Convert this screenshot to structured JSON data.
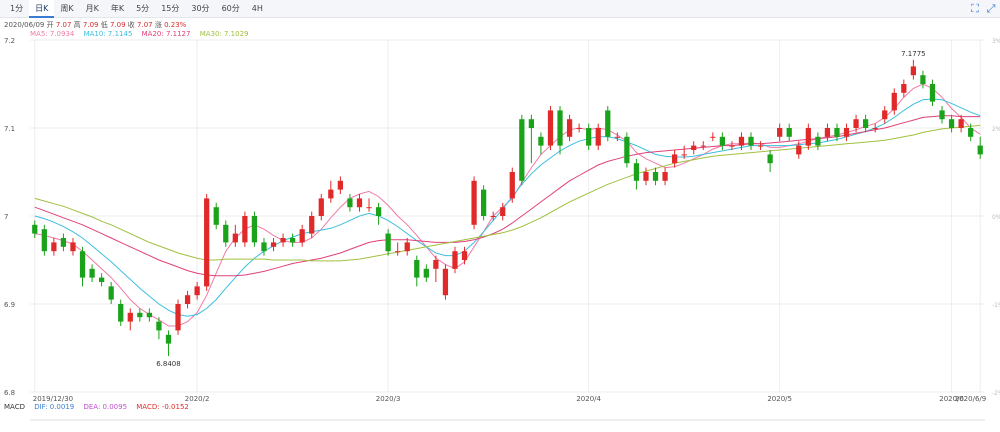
{
  "toolbar": {
    "tabs": [
      "1分",
      "日K",
      "周K",
      "月K",
      "年K",
      "5分",
      "15分",
      "30分",
      "60分",
      "4H"
    ],
    "active_tab": 1,
    "tool_icons": [
      "crosshair-icon",
      "fullscreen-icon"
    ]
  },
  "ohlc_bar": {
    "date": "2020/06/09",
    "open_label": "开",
    "open": "7.07",
    "high_label": "高",
    "high": "7.09",
    "low_label": "低",
    "low": "7.09",
    "close_label": "收",
    "close": "7.07",
    "change_label": "涨",
    "change": "0.23%"
  },
  "ma_legend": [
    {
      "label": "MA5: 7.0934",
      "color": "#f07aa6"
    },
    {
      "label": "MA10: 7.1145",
      "color": "#3bbfe0"
    },
    {
      "label": "MA20: 7.1127",
      "color": "#e0407a"
    },
    {
      "label": "MA30: 7.1029",
      "color": "#a0c040"
    }
  ],
  "macd_legend": [
    {
      "label": "MACD",
      "color": "#333333"
    },
    {
      "label": "DIF: 0.0019",
      "color": "#3a7bd5"
    },
    {
      "label": "DEA: 0.0095",
      "color": "#c050d0"
    },
    {
      "label": "MACD: -0.0152",
      "color": "#e02a2a"
    }
  ],
  "colors": {
    "up": "#e02a2a",
    "down": "#1aa31a",
    "grid": "#eeeeee"
  },
  "chart_data": {
    "type": "candlestick",
    "ylim": [
      6.8,
      7.2
    ],
    "y_ticks": [
      "6.8",
      "6.9",
      "7",
      "7.1",
      "7.2"
    ],
    "right_ticks": [
      "3%",
      "2%",
      "0%",
      "-1%",
      "-2%"
    ],
    "x_labels": [
      {
        "i": 0,
        "text": "2019/12/30"
      },
      {
        "i": 17,
        "text": "2020/2"
      },
      {
        "i": 37,
        "text": "2020/3"
      },
      {
        "i": 58,
        "text": "2020/4"
      },
      {
        "i": 78,
        "text": "2020/5"
      },
      {
        "i": 96,
        "text": "2020/6"
      },
      {
        "i": 99,
        "text": "2020/6/9"
      }
    ],
    "annotations": [
      {
        "i": 14,
        "text": "6.8408",
        "value": 6.8408,
        "pos": "below"
      },
      {
        "i": 92,
        "text": "7.1775",
        "value": 7.1775,
        "pos": "above"
      }
    ],
    "candles": [
      [
        6.99,
        6.98,
        6.995,
        6.975
      ],
      [
        6.985,
        6.96,
        6.99,
        6.955
      ],
      [
        6.96,
        6.97,
        6.975,
        6.955
      ],
      [
        6.975,
        6.965,
        6.98,
        6.96
      ],
      [
        6.96,
        6.97,
        6.975,
        6.955
      ],
      [
        6.96,
        6.93,
        6.965,
        6.92
      ],
      [
        6.94,
        6.93,
        6.945,
        6.925
      ],
      [
        6.93,
        6.925,
        6.935,
        6.92
      ],
      [
        6.92,
        6.905,
        6.925,
        6.9
      ],
      [
        6.9,
        6.88,
        6.905,
        6.875
      ],
      [
        6.88,
        6.89,
        6.895,
        6.87
      ],
      [
        6.89,
        6.885,
        6.895,
        6.88
      ],
      [
        6.89,
        6.885,
        6.895,
        6.88
      ],
      [
        6.88,
        6.87,
        6.885,
        6.86
      ],
      [
        6.865,
        6.855,
        6.87,
        6.8408
      ],
      [
        6.87,
        6.9,
        6.905,
        6.865
      ],
      [
        6.9,
        6.91,
        6.915,
        6.895
      ],
      [
        6.91,
        6.92,
        6.925,
        6.905
      ],
      [
        6.92,
        7.02,
        7.025,
        6.915
      ],
      [
        7.01,
        6.99,
        7.015,
        6.985
      ],
      [
        6.99,
        6.97,
        6.995,
        6.965
      ],
      [
        6.97,
        6.98,
        6.99,
        6.965
      ],
      [
        6.97,
        7.0,
        7.005,
        6.965
      ],
      [
        7.0,
        6.97,
        7.005,
        6.965
      ],
      [
        6.97,
        6.96,
        6.975,
        6.955
      ],
      [
        6.965,
        6.97,
        6.975,
        6.96
      ],
      [
        6.97,
        6.975,
        6.98,
        6.965
      ],
      [
        6.975,
        6.97,
        6.98,
        6.965
      ],
      [
        6.97,
        6.985,
        6.99,
        6.965
      ],
      [
        6.98,
        7.0,
        7.005,
        6.975
      ],
      [
        7.0,
        7.02,
        7.025,
        6.995
      ],
      [
        7.02,
        7.03,
        7.04,
        7.015
      ],
      [
        7.03,
        7.04,
        7.045,
        7.025
      ],
      [
        7.02,
        7.01,
        7.025,
        7.005
      ],
      [
        7.01,
        7.02,
        7.025,
        7.005
      ],
      [
        7.01,
        7.01,
        7.02,
        7.005
      ],
      [
        7.01,
        7.0,
        7.015,
        6.99
      ],
      [
        6.98,
        6.96,
        6.985,
        6.955
      ],
      [
        6.96,
        6.96,
        6.97,
        6.955
      ],
      [
        6.96,
        6.97,
        6.975,
        6.955
      ],
      [
        6.95,
        6.93,
        6.955,
        6.92
      ],
      [
        6.94,
        6.93,
        6.945,
        6.925
      ],
      [
        6.94,
        6.95,
        6.955,
        6.925
      ],
      [
        6.91,
        6.94,
        6.945,
        6.905
      ],
      [
        6.94,
        6.96,
        6.965,
        6.935
      ],
      [
        6.95,
        6.96,
        6.965,
        6.945
      ],
      [
        6.99,
        7.04,
        7.045,
        6.985
      ],
      [
        7.03,
        7.0,
        7.035,
        6.995
      ],
      [
        7.0,
        7.0,
        7.005,
        6.995
      ],
      [
        7.0,
        7.01,
        7.015,
        6.995
      ],
      [
        7.02,
        7.05,
        7.055,
        7.015
      ],
      [
        7.11,
        7.04,
        7.115,
        7.035
      ],
      [
        7.11,
        7.1,
        7.115,
        7.06
      ],
      [
        7.09,
        7.08,
        7.095,
        7.07
      ],
      [
        7.08,
        7.12,
        7.125,
        7.075
      ],
      [
        7.12,
        7.08,
        7.125,
        7.07
      ],
      [
        7.09,
        7.11,
        7.115,
        7.085
      ],
      [
        7.1,
        7.1,
        7.105,
        7.095
      ],
      [
        7.1,
        7.08,
        7.105,
        7.075
      ],
      [
        7.08,
        7.1,
        7.105,
        7.075
      ],
      [
        7.12,
        7.09,
        7.125,
        7.085
      ],
      [
        7.09,
        7.09,
        7.095,
        7.085
      ],
      [
        7.09,
        7.06,
        7.095,
        7.055
      ],
      [
        7.06,
        7.04,
        7.065,
        7.03
      ],
      [
        7.04,
        7.05,
        7.055,
        7.035
      ],
      [
        7.05,
        7.04,
        7.055,
        7.035
      ],
      [
        7.04,
        7.05,
        7.055,
        7.035
      ],
      [
        7.06,
        7.07,
        7.075,
        7.055
      ],
      [
        7.07,
        7.07,
        7.08,
        7.065
      ],
      [
        7.075,
        7.08,
        7.085,
        7.07
      ],
      [
        7.08,
        7.08,
        7.085,
        7.075
      ],
      [
        7.09,
        7.09,
        7.095,
        7.085
      ],
      [
        7.09,
        7.08,
        7.095,
        7.075
      ],
      [
        7.08,
        7.08,
        7.085,
        7.075
      ],
      [
        7.08,
        7.09,
        7.095,
        7.075
      ],
      [
        7.09,
        7.08,
        7.095,
        7.075
      ],
      [
        7.08,
        7.08,
        7.085,
        7.075
      ],
      [
        7.07,
        7.06,
        7.075,
        7.05
      ],
      [
        7.09,
        7.1,
        7.105,
        7.085
      ],
      [
        7.1,
        7.09,
        7.105,
        7.085
      ],
      [
        7.07,
        7.08,
        7.085,
        7.065
      ],
      [
        7.08,
        7.1,
        7.105,
        7.075
      ],
      [
        7.09,
        7.08,
        7.095,
        7.075
      ],
      [
        7.09,
        7.1,
        7.105,
        7.085
      ],
      [
        7.1,
        7.09,
        7.105,
        7.085
      ],
      [
        7.09,
        7.1,
        7.105,
        7.085
      ],
      [
        7.1,
        7.11,
        7.115,
        7.095
      ],
      [
        7.11,
        7.1,
        7.115,
        7.095
      ],
      [
        7.1,
        7.1,
        7.105,
        7.095
      ],
      [
        7.11,
        7.12,
        7.125,
        7.105
      ],
      [
        7.12,
        7.14,
        7.145,
        7.115
      ],
      [
        7.14,
        7.15,
        7.155,
        7.135
      ],
      [
        7.16,
        7.17,
        7.1775,
        7.155
      ],
      [
        7.16,
        7.15,
        7.165,
        7.145
      ],
      [
        7.15,
        7.13,
        7.155,
        7.125
      ],
      [
        7.12,
        7.11,
        7.125,
        7.105
      ],
      [
        7.11,
        7.1,
        7.115,
        7.095
      ],
      [
        7.1,
        7.11,
        7.115,
        7.095
      ],
      [
        7.1,
        7.09,
        7.105,
        7.085
      ],
      [
        7.08,
        7.07,
        7.09,
        7.065
      ]
    ],
    "series": [
      {
        "name": "MA5",
        "color": "#f07aa6",
        "values": [
          6.98,
          6.978,
          6.975,
          6.972,
          6.968,
          6.96,
          6.95,
          6.94,
          6.93,
          6.918,
          6.905,
          6.895,
          6.888,
          6.882,
          6.875,
          6.875,
          6.88,
          6.89,
          6.91,
          6.935,
          6.96,
          6.975,
          6.985,
          6.99,
          6.985,
          6.978,
          6.972,
          6.97,
          6.97,
          6.975,
          6.985,
          6.998,
          7.01,
          7.02,
          7.025,
          7.028,
          7.022,
          7.012,
          7.0,
          6.99,
          6.978,
          6.965,
          6.952,
          6.945,
          6.94,
          6.948,
          6.965,
          6.982,
          7.0,
          7.01,
          7.02,
          7.038,
          7.055,
          7.07,
          7.08,
          7.09,
          7.098,
          7.1,
          7.098,
          7.1,
          7.098,
          7.092,
          7.085,
          7.072,
          7.065,
          7.06,
          7.055,
          7.056,
          7.06,
          7.065,
          7.07,
          7.076,
          7.08,
          7.082,
          7.082,
          7.083,
          7.082,
          7.078,
          7.078,
          7.08,
          7.082,
          7.085,
          7.088,
          7.09,
          7.092,
          7.095,
          7.098,
          7.102,
          7.105,
          7.112,
          7.122,
          7.135,
          7.145,
          7.15,
          7.145,
          7.135,
          7.122,
          7.112,
          7.1,
          7.093
        ]
      },
      {
        "name": "MA10",
        "color": "#3bbfe0",
        "values": [
          7.0,
          6.997,
          6.993,
          6.988,
          6.982,
          6.975,
          6.966,
          6.957,
          6.948,
          6.938,
          6.928,
          6.918,
          6.909,
          6.9,
          6.893,
          6.888,
          6.886,
          6.888,
          6.895,
          6.905,
          6.918,
          6.93,
          6.942,
          6.952,
          6.96,
          6.966,
          6.972,
          6.976,
          6.98,
          6.982,
          6.984,
          6.986,
          6.99,
          6.995,
          7.0,
          7.003,
          7.0,
          6.995,
          6.988,
          6.98,
          6.972,
          6.965,
          6.958,
          6.955,
          6.955,
          6.96,
          6.97,
          6.982,
          6.995,
          7.008,
          7.022,
          7.036,
          7.048,
          7.058,
          7.066,
          7.074,
          7.08,
          7.085,
          7.088,
          7.09,
          7.09,
          7.088,
          7.084,
          7.08,
          7.075,
          7.07,
          7.068,
          7.067,
          7.067,
          7.068,
          7.07,
          7.072,
          7.074,
          7.076,
          7.078,
          7.08,
          7.08,
          7.08,
          7.08,
          7.08,
          7.081,
          7.082,
          7.083,
          7.085,
          7.087,
          7.09,
          7.093,
          7.096,
          7.1,
          7.105,
          7.112,
          7.12,
          7.127,
          7.132,
          7.133,
          7.132,
          7.128,
          7.123,
          7.118,
          7.114
        ]
      },
      {
        "name": "MA20",
        "color": "#e0407a",
        "values": [
          7.01,
          7.006,
          7.002,
          6.998,
          6.994,
          6.99,
          6.985,
          6.98,
          6.975,
          6.97,
          6.965,
          6.96,
          6.955,
          6.95,
          6.946,
          6.942,
          6.938,
          6.935,
          6.933,
          6.932,
          6.932,
          6.932,
          6.933,
          6.935,
          6.937,
          6.94,
          6.943,
          6.946,
          6.948,
          6.95,
          6.952,
          6.955,
          6.958,
          6.962,
          6.966,
          6.97,
          6.972,
          6.973,
          6.973,
          6.973,
          6.972,
          6.971,
          6.97,
          6.97,
          6.97,
          6.971,
          6.973,
          6.976,
          6.98,
          6.985,
          6.992,
          7.0,
          7.008,
          7.016,
          7.024,
          7.032,
          7.04,
          7.046,
          7.052,
          7.058,
          7.062,
          7.065,
          7.068,
          7.07,
          7.072,
          7.073,
          7.074,
          7.075,
          7.076,
          7.077,
          7.078,
          7.079,
          7.08,
          7.08,
          7.081,
          7.082,
          7.082,
          7.083,
          7.084,
          7.085,
          7.086,
          7.087,
          7.088,
          7.089,
          7.09,
          7.092,
          7.094,
          7.096,
          7.098,
          7.1,
          7.103,
          7.106,
          7.109,
          7.112,
          7.113,
          7.114,
          7.114,
          7.113,
          7.113,
          7.113
        ]
      },
      {
        "name": "MA30",
        "color": "#a0c040",
        "values": [
          7.02,
          7.017,
          7.014,
          7.011,
          7.007,
          7.003,
          6.999,
          6.994,
          6.99,
          6.985,
          6.98,
          6.975,
          6.97,
          6.966,
          6.962,
          6.958,
          6.955,
          6.952,
          6.95,
          6.95,
          6.951,
          6.951,
          6.951,
          6.951,
          6.951,
          6.95,
          6.95,
          6.95,
          6.95,
          6.949,
          6.949,
          6.949,
          6.949,
          6.95,
          6.951,
          6.953,
          6.955,
          6.957,
          6.959,
          6.961,
          6.963,
          6.965,
          6.967,
          6.969,
          6.971,
          6.973,
          6.975,
          6.977,
          6.979,
          6.981,
          6.984,
          6.988,
          6.993,
          6.998,
          7.004,
          7.01,
          7.016,
          7.021,
          7.026,
          7.031,
          7.036,
          7.04,
          7.044,
          7.048,
          7.051,
          7.054,
          7.057,
          7.06,
          7.062,
          7.064,
          7.066,
          7.068,
          7.069,
          7.07,
          7.071,
          7.072,
          7.073,
          7.074,
          7.075,
          7.076,
          7.077,
          7.078,
          7.079,
          7.08,
          7.081,
          7.082,
          7.083,
          7.084,
          7.085,
          7.086,
          7.088,
          7.09,
          7.092,
          7.095,
          7.097,
          7.099,
          7.1,
          7.101,
          7.102,
          7.103
        ]
      }
    ]
  }
}
